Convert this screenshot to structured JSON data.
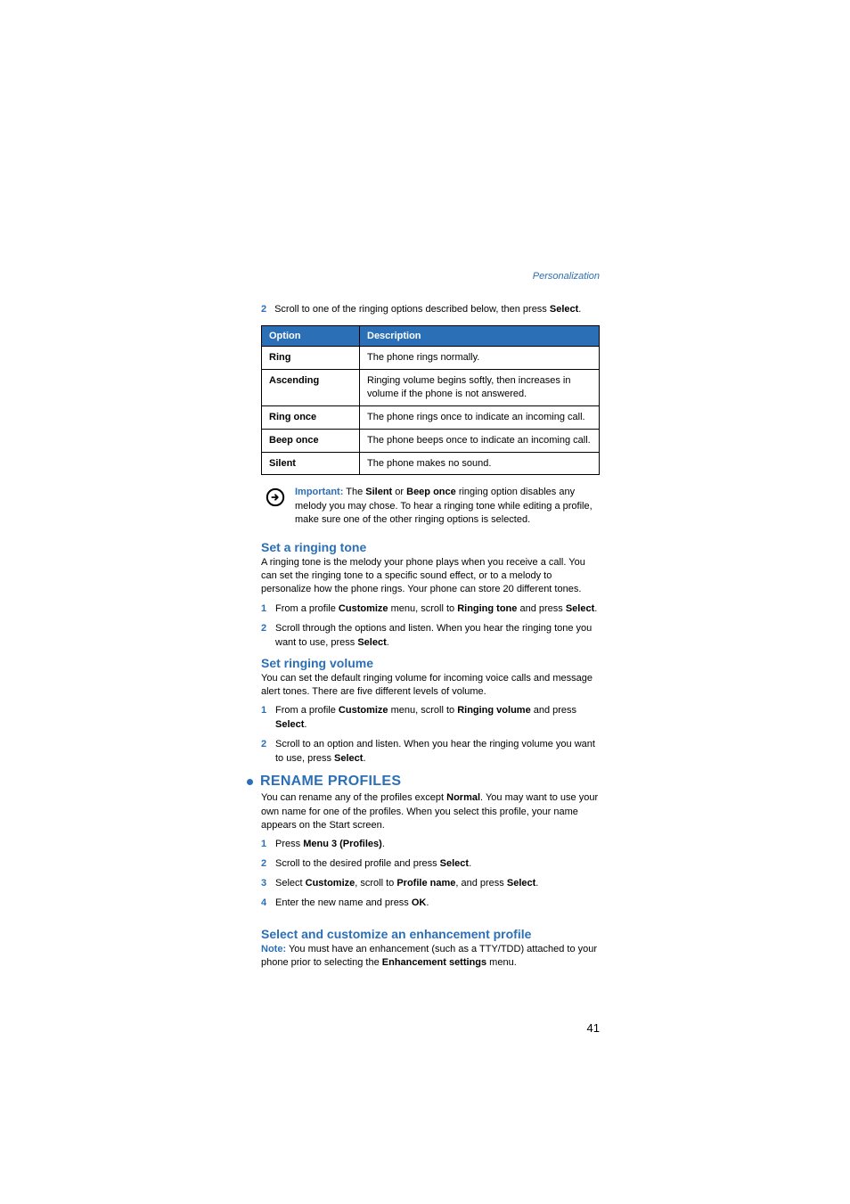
{
  "header": {
    "section": "Personalization"
  },
  "intro": {
    "num": "2",
    "text_pre": "Scroll to one of the ringing options described below, then press ",
    "text_bold": "Select",
    "text_post": "."
  },
  "table": {
    "headers": {
      "option": "Option",
      "description": "Description"
    },
    "rows": [
      {
        "option": "Ring",
        "description": "The phone rings normally."
      },
      {
        "option": "Ascending",
        "description": "Ringing volume begins softly, then increases in volume if the phone is not answered."
      },
      {
        "option": "Ring once",
        "description": "The phone rings once to indicate an incoming call."
      },
      {
        "option": "Beep once",
        "description": "The phone beeps once to indicate an incoming call."
      },
      {
        "option": "Silent",
        "description": "The phone makes no sound."
      }
    ]
  },
  "important": {
    "label": "Important:",
    "t1": " The ",
    "b1": "Silent",
    "t2": " or ",
    "b2": "Beep once",
    "t3": " ringing option disables any melody you may chose. To hear a ringing tone while editing a profile, make sure one of the other ringing options is selected."
  },
  "set_tone": {
    "title": "Set a ringing tone",
    "body": "A ringing tone is the melody your phone plays when you receive a call. You can set the ringing tone to a specific sound effect, or to a melody to personalize how the phone rings. Your phone can store 20 different tones.",
    "steps": [
      {
        "n": "1",
        "parts": [
          "From a profile ",
          "Customize",
          " menu, scroll to ",
          "Ringing tone",
          " and press ",
          "Select",
          "."
        ]
      },
      {
        "n": "2",
        "parts": [
          "Scroll through the options and listen. When you hear the ringing tone you want to use, press ",
          "Select",
          "."
        ]
      }
    ]
  },
  "set_volume": {
    "title": "Set ringing volume",
    "body": "You can set the default ringing volume for incoming voice calls and message alert tones. There are five different levels of volume.",
    "steps": [
      {
        "n": "1",
        "parts": [
          "From a profile ",
          "Customize",
          " menu, scroll to ",
          "Ringing volume",
          " and press ",
          "Select",
          "."
        ]
      },
      {
        "n": "2",
        "parts": [
          "Scroll to an option and listen. When you hear the ringing volume you want to use, press ",
          "Select",
          "."
        ]
      }
    ]
  },
  "rename": {
    "title": "RENAME PROFILES",
    "body_pre": "You can rename any of the profiles except ",
    "body_bold": "Normal",
    "body_post": ". You may want to use your own name for one of the profiles. When you select this profile, your name appears on the Start screen.",
    "steps": [
      {
        "n": "1",
        "parts": [
          "Press ",
          "Menu 3 (Profiles)",
          "."
        ]
      },
      {
        "n": "2",
        "parts": [
          "Scroll to the desired profile and press ",
          "Select",
          "."
        ]
      },
      {
        "n": "3",
        "parts": [
          "Select ",
          "Customize",
          ", scroll to ",
          "Profile name",
          ", and press ",
          "Select",
          "."
        ]
      },
      {
        "n": "4",
        "parts": [
          "Enter the new name and press ",
          "OK",
          "."
        ]
      }
    ]
  },
  "enhancement": {
    "title": "Select and customize an enhancement profile",
    "note_label": "Note:",
    "t1": "  You must have an enhancement (such as a TTY/TDD) attached to your phone prior to selecting the ",
    "b1": "Enhancement settings",
    "t2": " menu."
  },
  "page_number": "41"
}
